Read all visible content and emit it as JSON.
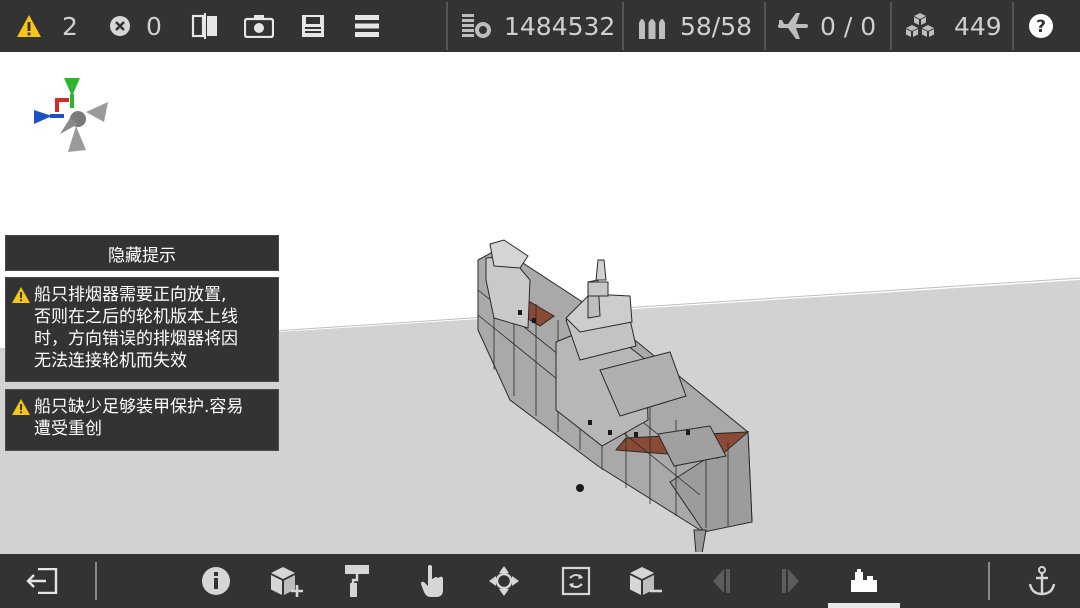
{
  "topbar": {
    "warnings_count": "2",
    "errors_count": "0",
    "cost": "1484532",
    "ammo": "58/58",
    "aircraft": "0 / 0",
    "blocks": "449",
    "warning_color": "#f5c518"
  },
  "hints": {
    "header": "隐藏提示",
    "warnings": [
      {
        "text_lines": [
          "船只排烟器需要正向放置,",
          "否则在之后的轮机版本上线",
          "时，方向错误的排烟器将因",
          "无法连接轮机而失效"
        ]
      },
      {
        "text_lines": [
          "船只缺少足够装甲保护.容易",
          "遭受重创"
        ]
      }
    ]
  },
  "bottombar": {
    "items": [
      "exit-icon",
      "info-icon",
      "add-block-icon",
      "paint-roller-icon",
      "hand-icon",
      "move-icon",
      "rotate-icon",
      "remove-block-icon",
      "prev-icon",
      "next-icon",
      "build-mode-icon",
      "anchor-icon"
    ],
    "active": "build-mode-icon"
  }
}
